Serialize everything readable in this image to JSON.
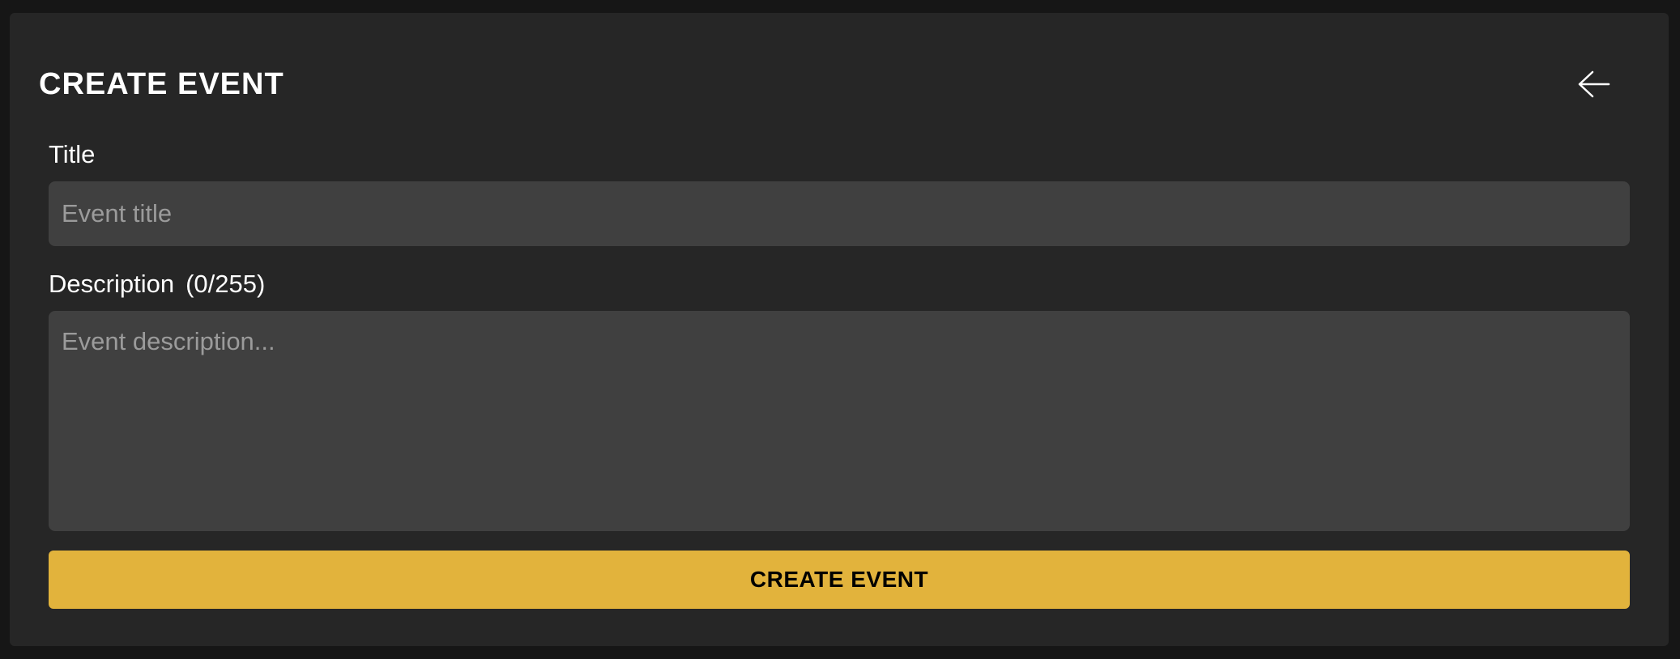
{
  "header": {
    "title": "CREATE EVENT",
    "back_icon": "arrow-left-icon"
  },
  "form": {
    "title_label": "Title",
    "title_placeholder": "Event title",
    "title_value": "",
    "description_label": "Description",
    "description_count": "(0/255)",
    "description_placeholder": "Event description...",
    "description_value": "",
    "submit_label": "CREATE EVENT"
  },
  "colors": {
    "background": "#161616",
    "panel": "#262626",
    "input": "#404040",
    "accent": "#e2b33c",
    "text": "#ffffff",
    "placeholder": "#9b9b9b"
  }
}
